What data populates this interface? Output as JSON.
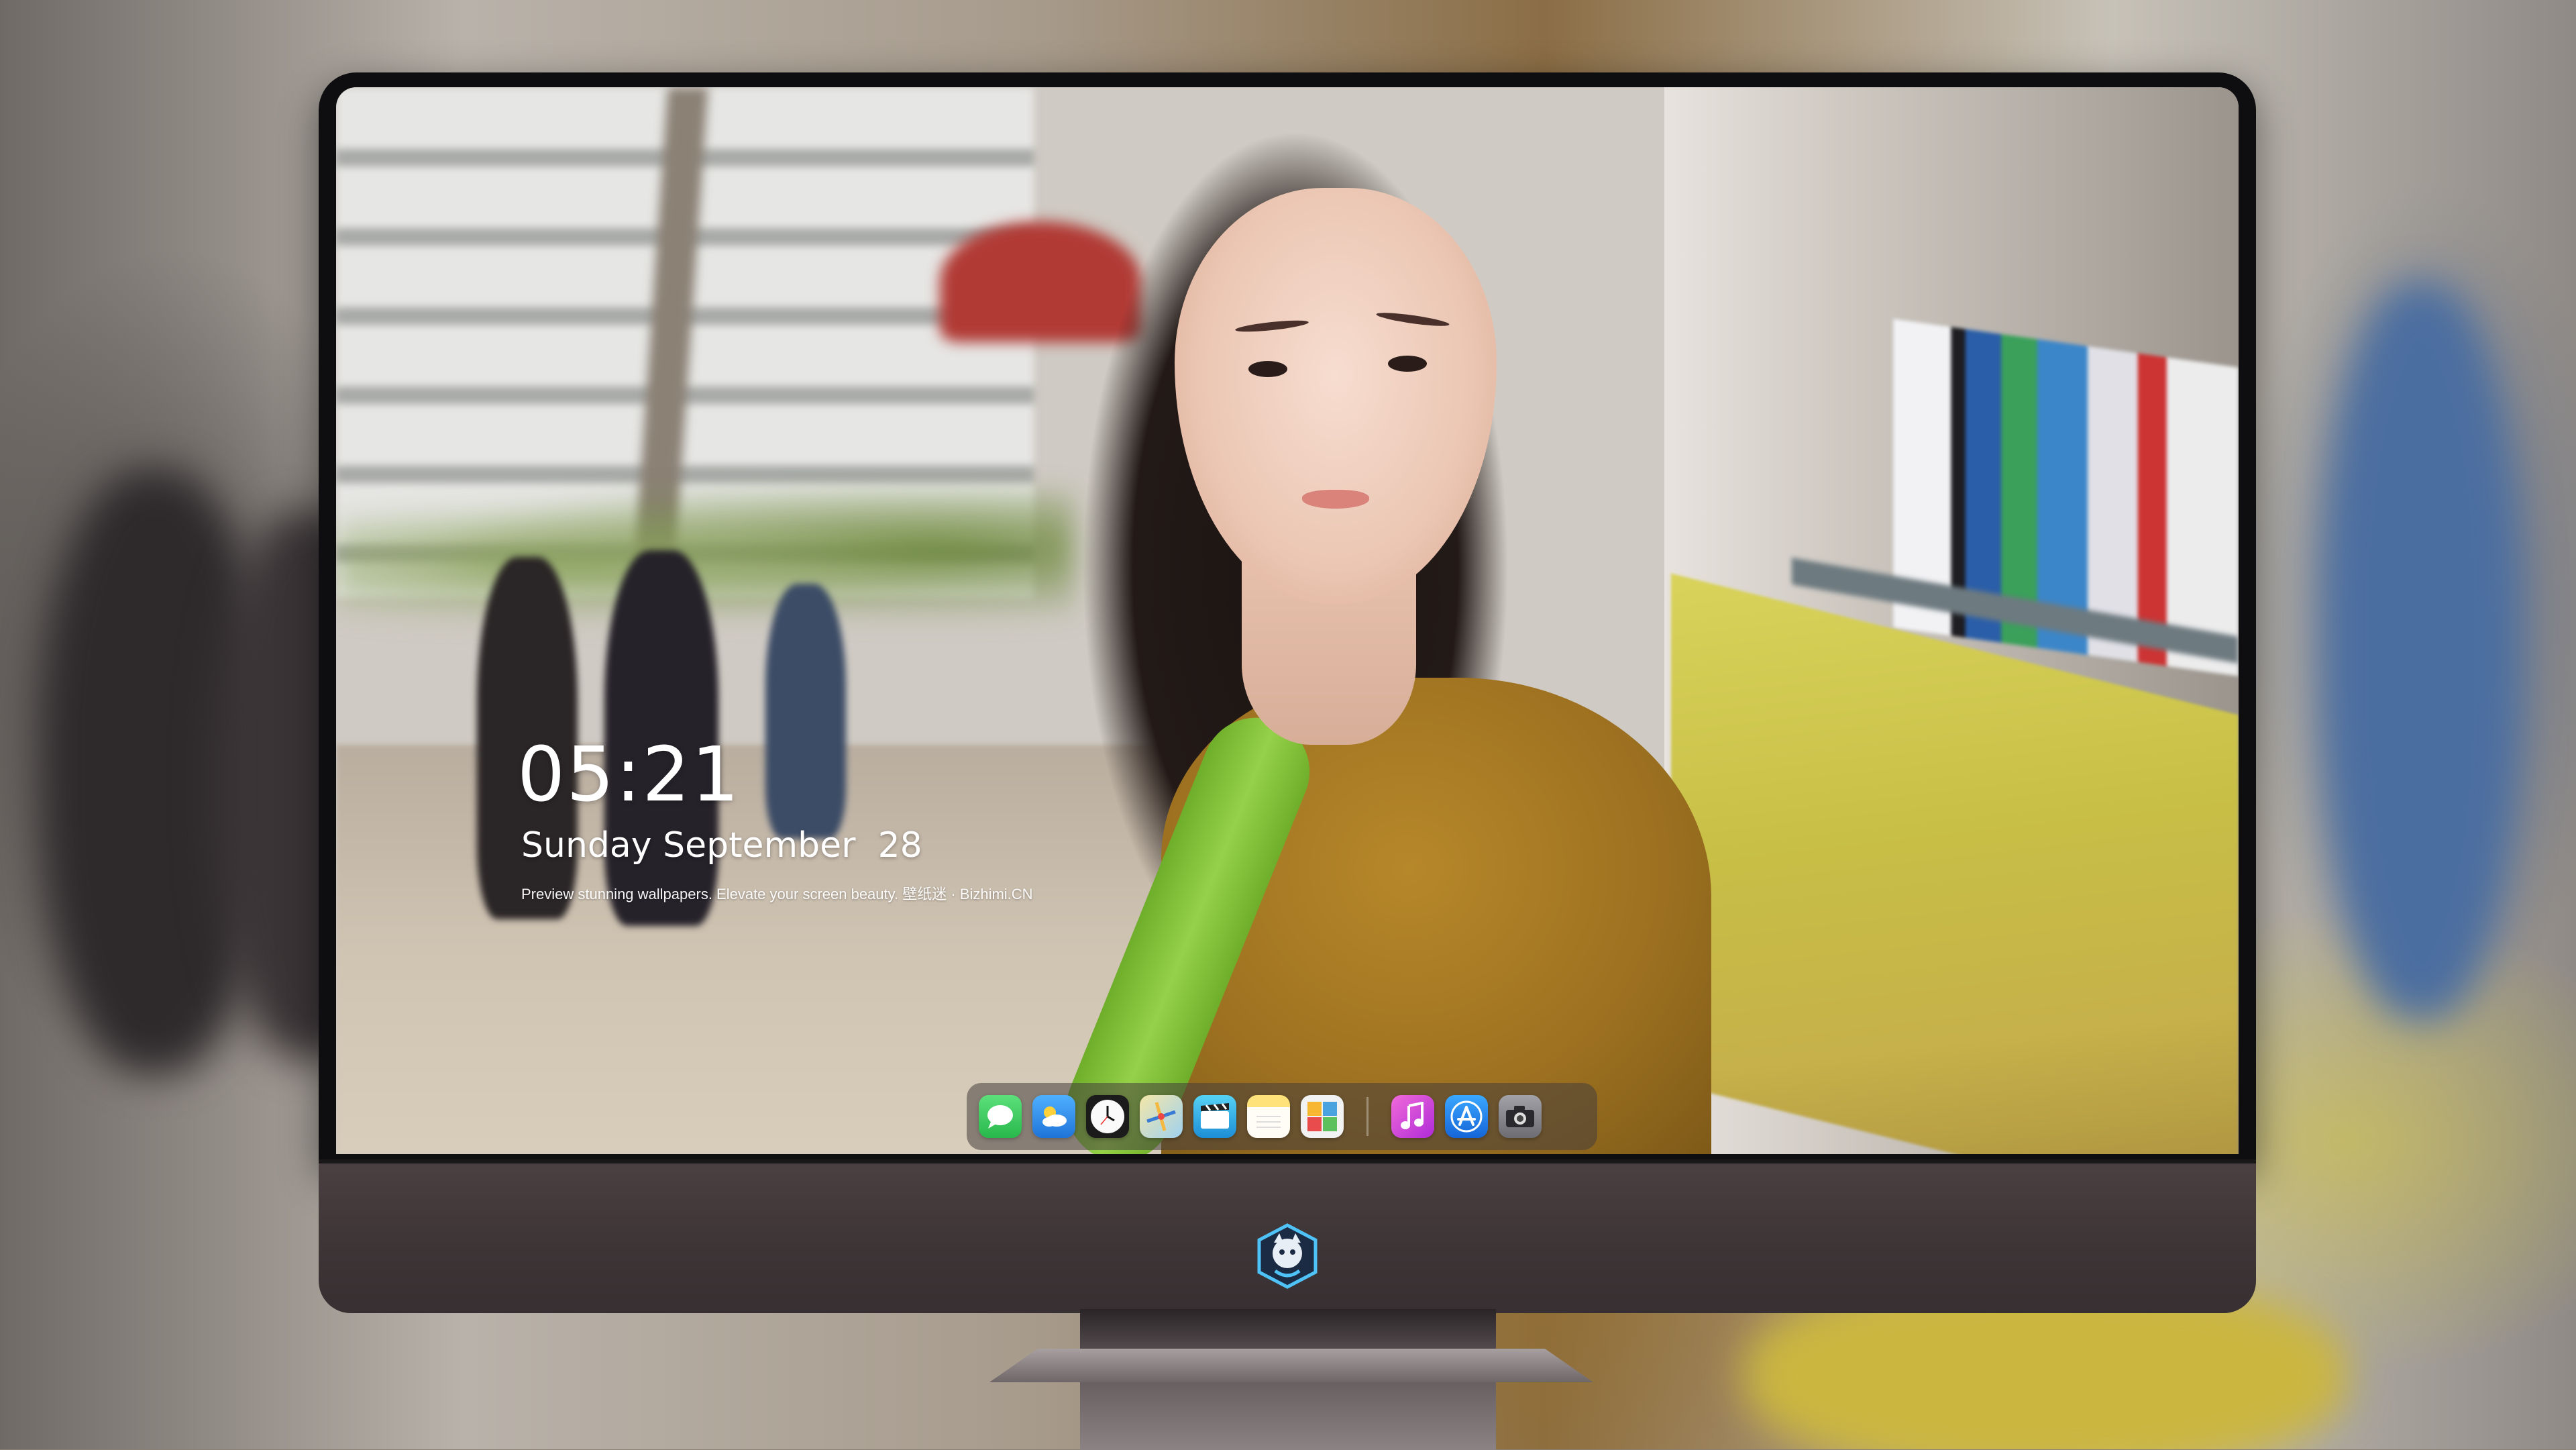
{
  "lock_screen": {
    "time": "05:21",
    "date": "Sunday September  28",
    "tagline": "Preview stunning wallpapers. Elevate your screen beauty. 壁纸迷 · Bizhimi.CN"
  },
  "dock": {
    "apps": [
      {
        "name": "Messages",
        "icon": "messages-icon",
        "color": "#34c759"
      },
      {
        "name": "Weather",
        "icon": "weather-icon",
        "color": "#2f8ff0"
      },
      {
        "name": "Clock",
        "icon": "clock-icon",
        "color": "#f5f5f5"
      },
      {
        "name": "Maps",
        "icon": "maps-icon",
        "color": "#e9d27a"
      },
      {
        "name": "Clips",
        "icon": "clips-icon",
        "color": "#3bb6e8"
      },
      {
        "name": "Notes",
        "icon": "notes-icon",
        "color": "#ffd54a"
      },
      {
        "name": "Photos",
        "icon": "photos-icon",
        "color": "#e7e7e7"
      }
    ],
    "pinned": [
      {
        "name": "iTunes",
        "icon": "itunes-icon",
        "color": "#e04bd6"
      },
      {
        "name": "App Store",
        "icon": "app-store-icon",
        "color": "#1e90ff"
      },
      {
        "name": "Camera",
        "icon": "camera-icon",
        "color": "#8e8e93"
      }
    ]
  },
  "monitor": {
    "chin_logo": "bizhimi-logo",
    "bezel_color": "#0e0d10",
    "chin_color": "#3d3436"
  }
}
